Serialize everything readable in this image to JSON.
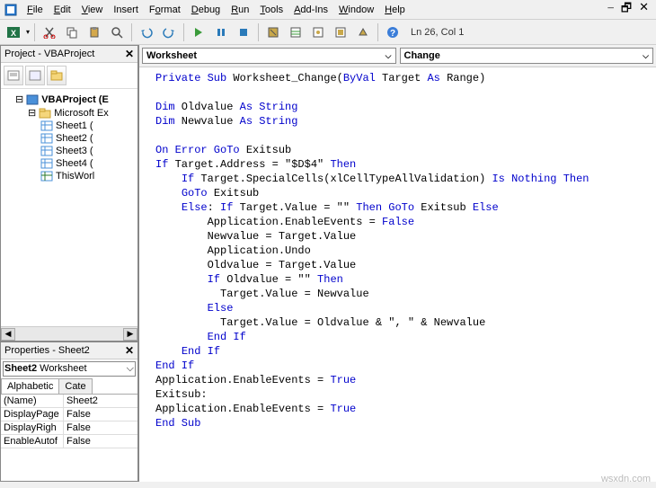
{
  "menu": {
    "file": "File",
    "edit": "Edit",
    "view": "View",
    "insert": "Insert",
    "format": "Format",
    "debug": "Debug",
    "run": "Run",
    "tools": "Tools",
    "addins": "Add-Ins",
    "window": "Window",
    "help": "Help"
  },
  "window_controls": {
    "min": "–",
    "restore": "🗗",
    "close": "✕"
  },
  "toolbar_status": "Ln 26, Col 1",
  "project_panel": {
    "title": "Project - VBAProject",
    "root": "VBAProject (E",
    "folder": "Microsoft Ex",
    "sheets": [
      "Sheet1 (",
      "Sheet2 (",
      "Sheet3 (",
      "Sheet4 ("
    ],
    "thiswb": "ThisWorl"
  },
  "props_panel": {
    "title": "Properties - Sheet2",
    "select": "Sheet2 Worksheet",
    "tabs": {
      "alpha": "Alphabetic",
      "cat": "Cate"
    },
    "rows": [
      {
        "name": "(Name)",
        "value": "Sheet2"
      },
      {
        "name": "DisplayPage",
        "value": "False"
      },
      {
        "name": "DisplayRigh",
        "value": "False"
      },
      {
        "name": "EnableAutof",
        "value": "False"
      }
    ]
  },
  "dropdowns": {
    "left": "Worksheet",
    "right": "Change"
  },
  "code": {
    "l1a": "Private Sub",
    "l1b": " Worksheet_Change(",
    "l1c": "ByVal",
    "l1d": " Target ",
    "l1e": "As",
    "l1f": " Range)",
    "l2a": "Dim",
    "l2b": " Oldvalue ",
    "l2c": "As String",
    "l3a": "Dim",
    "l3b": " Newvalue ",
    "l3c": "As String",
    "l4a": "On Error GoTo",
    "l4b": " Exitsub",
    "l5a": "If",
    "l5b": " Target.Address = \"$D$4\" ",
    "l5c": "Then",
    "l6a": "If",
    "l6b": " Target.SpecialCells(xlCellTypeAllValidation) ",
    "l6c": "Is Nothing Then",
    "l7a": "GoTo",
    "l7b": " Exitsub",
    "l8a": "Else",
    "l8b": ": ",
    "l8c": "If",
    "l8d": " Target.Value = \"\" ",
    "l8e": "Then GoTo",
    "l8f": " Exitsub ",
    "l8g": "Else",
    "l9a": "Application.EnableEvents = ",
    "l9b": "False",
    "l10": "Newvalue = Target.Value",
    "l11": "Application.Undo",
    "l12": "Oldvalue = Target.Value",
    "l13a": "If",
    "l13b": " Oldvalue = \"\" ",
    "l13c": "Then",
    "l14": "Target.Value = Newvalue",
    "l15": "Else",
    "l16": "Target.Value = Oldvalue & \", \" & Newvalue",
    "l17": "End If",
    "l18": "End If",
    "l19": "End If",
    "l20a": "Application.EnableEvents = ",
    "l20b": "True",
    "l21": "Exitsub:",
    "l22a": "Application.EnableEvents = ",
    "l22b": "True",
    "l23": "End Sub"
  },
  "watermark": "wsxdn.com"
}
